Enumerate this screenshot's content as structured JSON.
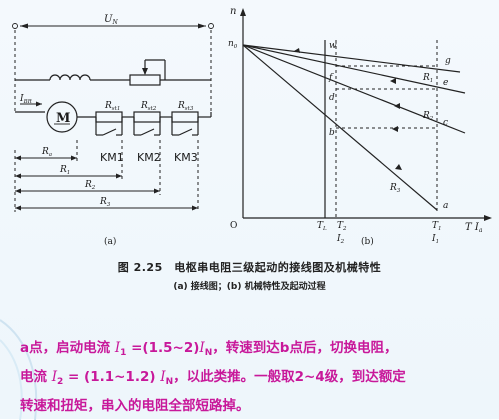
{
  "circuit": {
    "un": "U",
    "un_sub": "N",
    "ibr": "I",
    "ibr_sub": "BR",
    "motor": "M",
    "res": [
      "R",
      "R",
      "R"
    ],
    "res_sub": [
      "st1",
      "st2",
      "st3"
    ],
    "km": [
      "KM1",
      "KM2",
      "KM3"
    ],
    "dims": [
      {
        "name": "R",
        "sub": "a"
      },
      {
        "name": "R",
        "sub": "1"
      },
      {
        "name": "R",
        "sub": "2"
      },
      {
        "name": "R",
        "sub": "3"
      }
    ],
    "label": "(a)"
  },
  "graph": {
    "n_axis": "n",
    "n0": "n",
    "n0_sub": "0",
    "origin": "O",
    "x_axis": "T I",
    "x_axis_sub": "a",
    "points": [
      "w",
      "g",
      "f",
      "e",
      "d",
      "c",
      "b",
      "a"
    ],
    "curves": [
      {
        "name": "R",
        "sub": "1"
      },
      {
        "name": "R",
        "sub": "2"
      },
      {
        "name": "R",
        "sub": "3"
      }
    ],
    "ticks": [
      {
        "top": "T",
        "top_sub": "L",
        "bottom": "",
        "bottom_sub": ""
      },
      {
        "top": "T",
        "top_sub": "2",
        "bottom": "I",
        "bottom_sub": "2"
      },
      {
        "top": "T",
        "top_sub": "1",
        "bottom": "I",
        "bottom_sub": "1"
      }
    ],
    "label": "(b)"
  },
  "caption": {
    "title": "图 2.25　电枢串电阻三级起动的接线图及机械特性",
    "subtitle": "(a) 接线图；(b) 机械特性及起动过程"
  },
  "body": {
    "line1": [
      "a点，启动电流 ",
      "I",
      "1",
      " =(1.5~2)",
      "I",
      "N",
      "，转速到达b点后，切换电阻，"
    ],
    "line2": [
      "电流 ",
      "I",
      "2",
      " = (1.1~1.2) ",
      "I",
      "N",
      "，以此类推。一般取2~4级，到达额定"
    ],
    "line3": "转速和扭矩，串入的电阻全部短路掉。"
  },
  "colors": {
    "accent": "#c8189a",
    "background": "#eef6fb",
    "ink": "#222222"
  }
}
